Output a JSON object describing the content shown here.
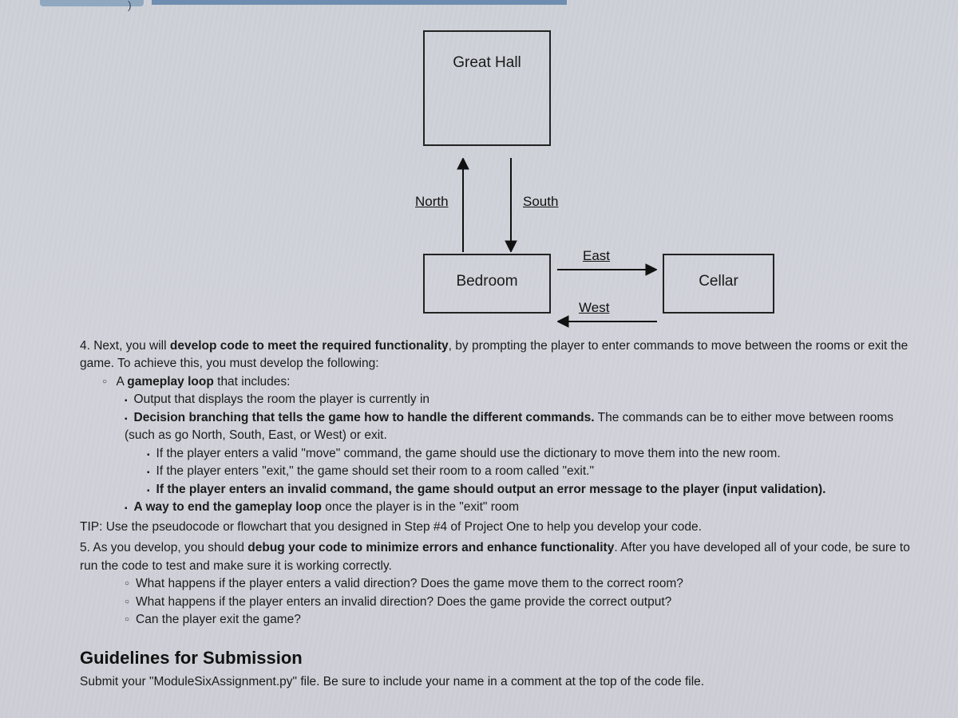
{
  "diagram": {
    "rooms": {
      "greatHall": "Great Hall",
      "bedroom": "Bedroom",
      "cellar": "Cellar"
    },
    "directions": {
      "north": "North",
      "south": "South",
      "east": "East",
      "west": "West"
    }
  },
  "item4": {
    "lead_a": "4. Next, you will ",
    "lead_b": "develop code to meet the required functionality",
    "lead_c": ", by prompting the player to enter commands to move between the rooms or exit the game. To achieve this, you must develop the following:",
    "bullets": {
      "o1_a": "A ",
      "o1_b": "gameplay loop",
      "o1_c": " that includes:",
      "s1": "Output that displays the room the player is currently in",
      "s2_a": "Decision branching that tells the game how to handle the different commands.",
      "s2_b": " The commands can be to either move between rooms (such as go North, South, East, or West) or exit.",
      "ss1": "If the player enters a valid \"move\" command, the game should use the dictionary to move them into the new room.",
      "ss2": "If the player enters \"exit,\" the game should set their room to a room called \"exit.\"",
      "ss3": "If the player enters an invalid command, the game should output an error message to the player (input validation).",
      "s3_a": "A way to end the gameplay loop",
      "s3_b": " once the player is in the \"exit\" room"
    },
    "tip": "TIP: Use the pseudocode or flowchart that you designed in Step #4 of Project One to help you develop your code."
  },
  "item5": {
    "lead_a": "5. As you develop, you should ",
    "lead_b": "debug your code to minimize errors and enhance functionality",
    "lead_c": ". After you have developed all of your code, be sure to run the code to test and make sure it is working correctly.",
    "q1": "What happens if the player enters a valid direction? Does the game move them to the correct room?",
    "q2": "What happens if the player enters an invalid direction? Does the game provide the correct output?",
    "q3": "Can the player exit the game?"
  },
  "guidelines": {
    "header": "Guidelines for Submission",
    "body": "Submit your \"ModuleSixAssignment.py\" file. Be sure to include your name in a comment at the top of the code file."
  },
  "topParen": ")"
}
